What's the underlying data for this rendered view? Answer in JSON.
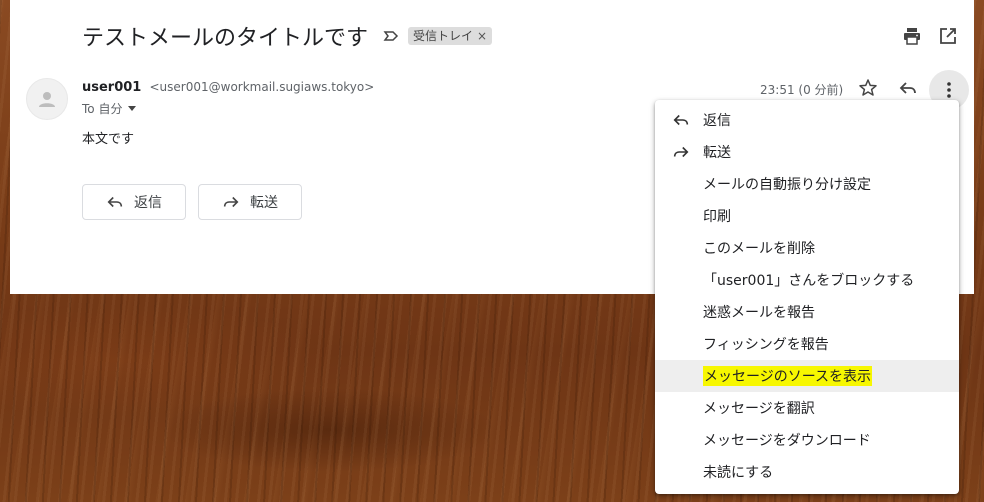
{
  "subject": "テストメールのタイトルです",
  "label_chip": {
    "text": "受信トレイ",
    "close": "×"
  },
  "sender": {
    "name": "user001",
    "email": "<user001@workmail.sugiaws.tokyo>"
  },
  "to_line": "To 自分",
  "body": "本文です",
  "time": "23:51 (0 分前)",
  "actions": {
    "reply": "返信",
    "forward": "転送"
  },
  "menu": {
    "items": [
      {
        "label": "返信",
        "icon": "reply-icon"
      },
      {
        "label": "転送",
        "icon": "forward-icon"
      },
      {
        "label": "メールの自動振り分け設定"
      },
      {
        "label": "印刷"
      },
      {
        "label": "このメールを削除"
      },
      {
        "label": "「user001」さんをブロックする"
      },
      {
        "label": "迷惑メールを報告"
      },
      {
        "label": "フィッシングを報告"
      },
      {
        "label": "メッセージのソースを表示",
        "highlighted": true
      },
      {
        "label": "メッセージを翻訳"
      },
      {
        "label": "メッセージをダウンロード"
      },
      {
        "label": "未読にする"
      }
    ]
  },
  "colors": {
    "highlight": "#f7f700",
    "menu_hover": "#eeeeee"
  }
}
